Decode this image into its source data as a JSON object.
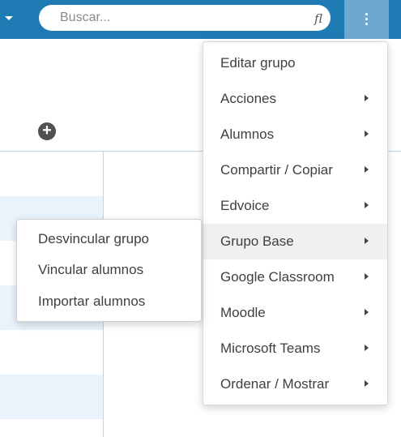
{
  "topbar": {
    "search_placeholder": "Buscar...",
    "search_icon_glyph": "fl",
    "left_caret_icon": "caret-down-icon",
    "menu_icon": "kebab-menu-icon"
  },
  "page": {
    "add_icon": "plus-circle-icon",
    "add_glyph": "+"
  },
  "menu": {
    "items": [
      {
        "label": "Editar grupo"
      },
      {
        "label": "Acciones"
      },
      {
        "label": "Alumnos"
      },
      {
        "label": "Compartir / Copiar"
      },
      {
        "label": "Edvoice"
      },
      {
        "label": "Grupo Base"
      },
      {
        "label": "Google Classroom"
      },
      {
        "label": "Moodle"
      },
      {
        "label": "Microsoft Teams"
      },
      {
        "label": "Ordenar / Mostrar"
      }
    ]
  },
  "submenu": {
    "items": [
      {
        "label": "Desvincular grupo"
      },
      {
        "label": "Vincular alumnos"
      },
      {
        "label": "Importar alumnos"
      }
    ]
  },
  "colors": {
    "topbar": "#1e7ab3",
    "menu_button_active": "#6fa8cf",
    "row_highlight": "#eaf2fb"
  }
}
